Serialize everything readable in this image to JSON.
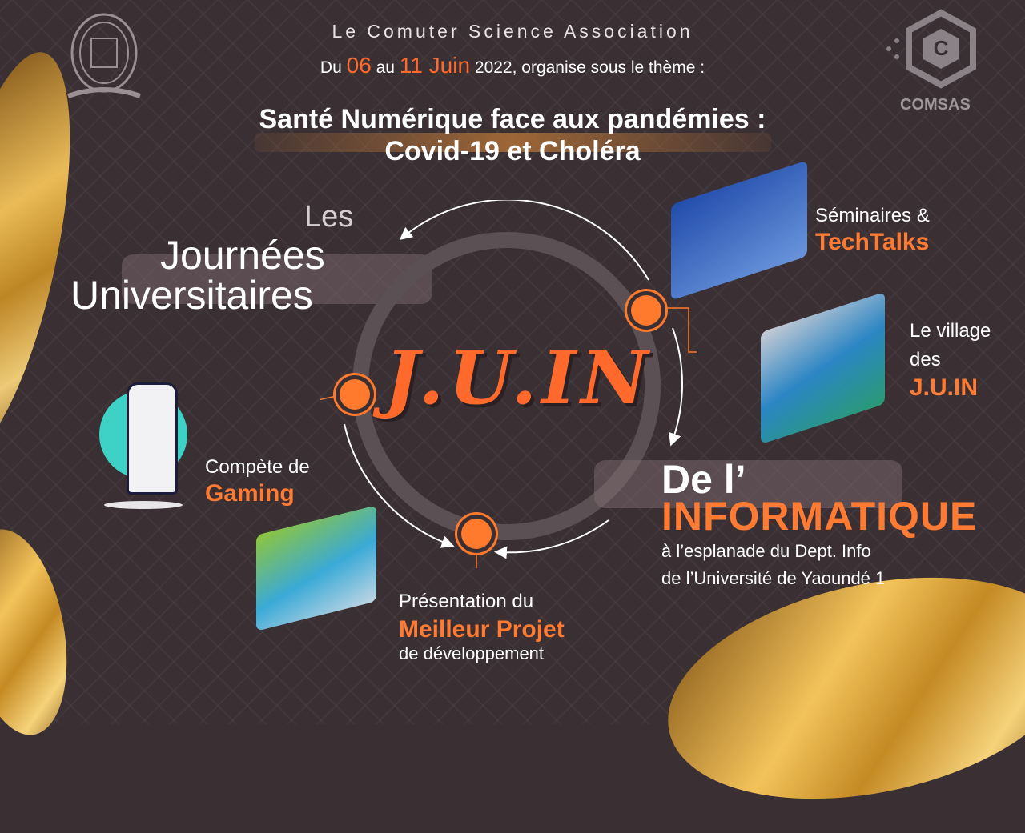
{
  "header": {
    "association": "Le Comuter Science Association",
    "dates_prefix": "Du",
    "date_start": "06",
    "dates_mid": "au",
    "date_end": "11 Juin",
    "dates_suffix": "2022, organise sous le thème :",
    "theme_line1": "Santé Numérique face aux pandémies :",
    "theme_line2": "Covid-19 et Choléra"
  },
  "logo_right": {
    "name": "COMSAS"
  },
  "title": {
    "les": "Les",
    "journees": "Journées",
    "universitaires": "Universitaires"
  },
  "center_logo": "J.U.IN",
  "activities": {
    "seminaires_line1": "Séminaires &",
    "seminaires_line2": "TechTalks",
    "village_line1": "Le village",
    "village_line2": "des",
    "village_line3": "J.U.IN",
    "gaming_line1": "Compète de",
    "gaming_line2": "Gaming",
    "projet_line1": "Présentation du",
    "projet_line2": "Meilleur Projet",
    "projet_line3": "de développement"
  },
  "informatique": {
    "line1": "De l’",
    "line2": "INFORMATIQUE",
    "location1": "à l’esplanade du Dept. Info",
    "location2": "de l’Université de Yaoundé 1"
  },
  "colors": {
    "accent": "#ff7a32",
    "background": "#3a3034",
    "gold": "#e8b24a"
  }
}
